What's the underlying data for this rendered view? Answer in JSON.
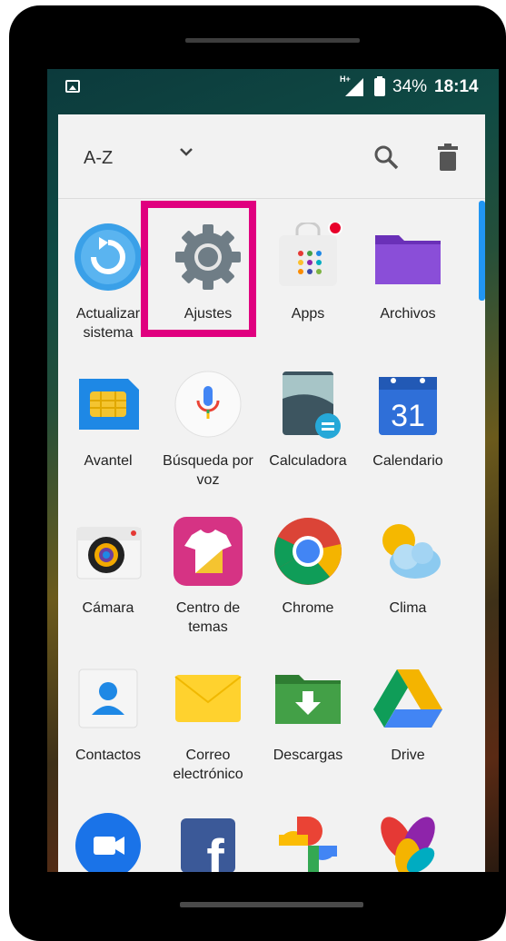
{
  "status_bar": {
    "network": "H+",
    "battery_percent": "34%",
    "time": "18:14"
  },
  "toolbar": {
    "sort_label": "A-Z"
  },
  "apps": [
    {
      "label": "Actualizar\nsistema",
      "icon": "system-update-icon"
    },
    {
      "label": "Ajustes",
      "icon": "settings-gear-icon"
    },
    {
      "label": "Apps",
      "icon": "app-store-icon"
    },
    {
      "label": "Archivos",
      "icon": "folder-icon"
    },
    {
      "label": "Avantel",
      "icon": "sim-card-icon"
    },
    {
      "label": "Búsqueda por\nvoz",
      "icon": "microphone-icon"
    },
    {
      "label": "Calculadora",
      "icon": "calculator-icon"
    },
    {
      "label": "Calendario",
      "icon": "calendar-icon",
      "icon_text": "31"
    },
    {
      "label": "Cámara",
      "icon": "camera-icon"
    },
    {
      "label": "Centro de\ntemas",
      "icon": "theme-shirt-icon"
    },
    {
      "label": "Chrome",
      "icon": "chrome-icon"
    },
    {
      "label": "Clima",
      "icon": "weather-icon"
    },
    {
      "label": "Contactos",
      "icon": "contacts-icon"
    },
    {
      "label": "Correo\nelectrónico",
      "icon": "email-icon"
    },
    {
      "label": "Descargas",
      "icon": "downloads-icon"
    },
    {
      "label": "Drive",
      "icon": "drive-icon"
    },
    {
      "label": "",
      "icon": "duo-icon"
    },
    {
      "label": "",
      "icon": "facebook-icon",
      "icon_text": "f"
    },
    {
      "label": "",
      "icon": "photos-icon"
    },
    {
      "label": "",
      "icon": "pinwheel-icon"
    }
  ],
  "highlighted_app": "Ajustes",
  "colors": {
    "highlight": "#e0007f",
    "drawer_bg": "#f2f2f2",
    "scrollbar": "#2196f3"
  }
}
